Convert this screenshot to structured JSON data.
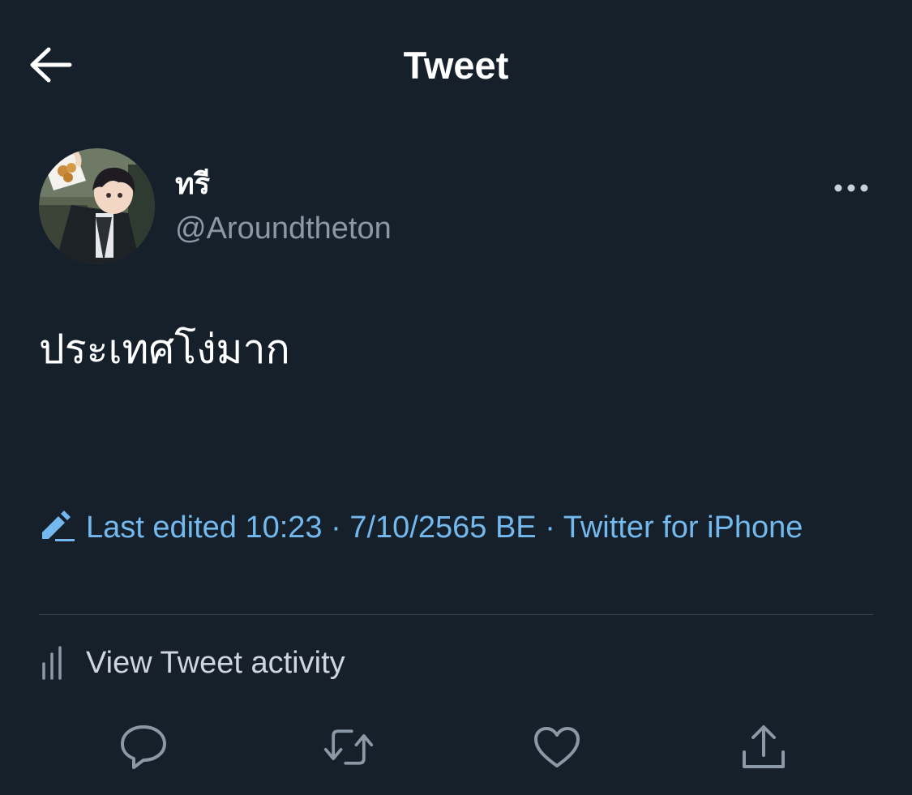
{
  "header": {
    "title": "Tweet",
    "back_icon": "arrow-left-icon"
  },
  "author": {
    "display_name": "ทรี",
    "handle": "@Aroundtheton",
    "avatar": "anime-character-avatar"
  },
  "more_icon": "more-horizontal-icon",
  "tweet": {
    "text": "ประเทศโง่มาก"
  },
  "meta": {
    "edit_icon": "pencil-icon",
    "text": "Last edited 10:23 · 7/10/2565 BE  · Twitter for iPhone"
  },
  "activity": {
    "label": "View Tweet activity",
    "icon": "bar-chart-icon"
  },
  "actions": {
    "reply_icon": "reply-icon",
    "retweet_icon": "retweet-icon",
    "like_icon": "heart-icon",
    "share_icon": "share-icon"
  },
  "colors": {
    "background": "#15202b",
    "accent": "#74b9ee",
    "secondary_text": "#8b98a5",
    "divider": "#38444d"
  }
}
